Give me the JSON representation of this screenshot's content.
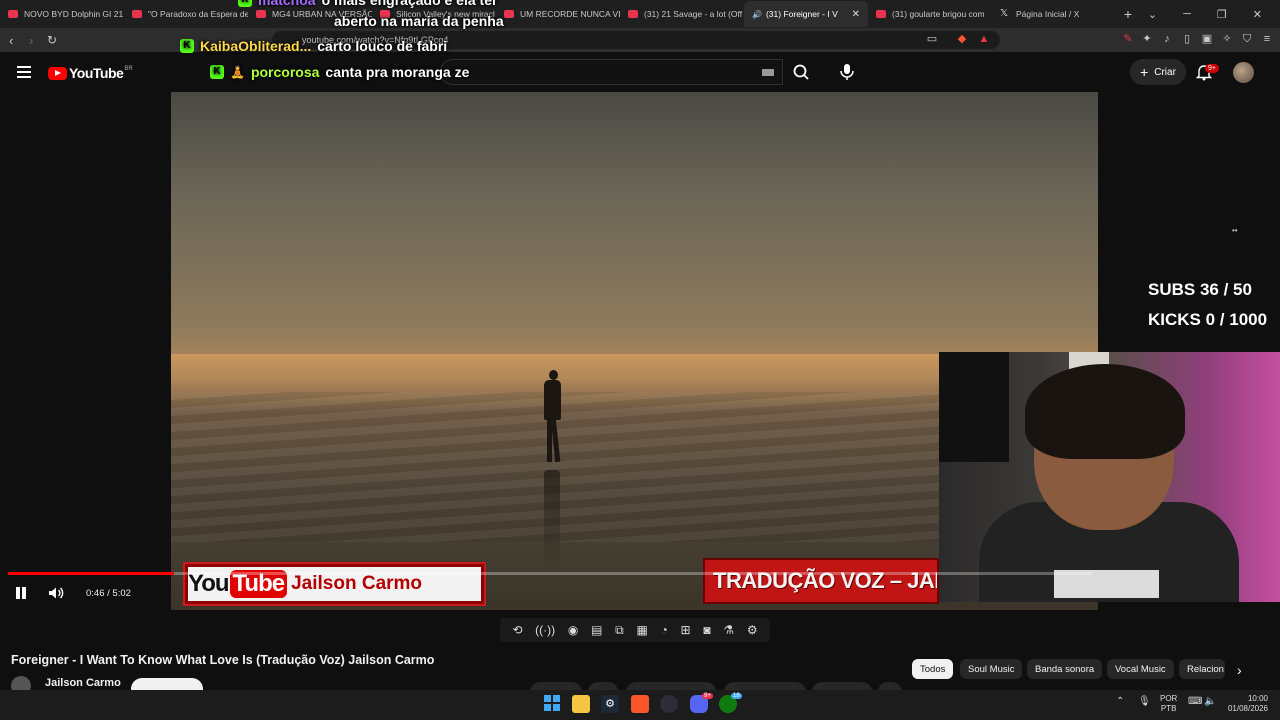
{
  "browser": {
    "tabs": [
      {
        "label": "NOVO BYD Dolphin GI 21",
        "favicon": "youtube-icon",
        "active": false
      },
      {
        "label": "\"O Paradoxo da Espera de",
        "favicon": "youtube-icon",
        "active": false
      },
      {
        "label": "MG4 URBAN NA VERSÃO",
        "favicon": "youtube-icon",
        "active": false
      },
      {
        "label": "Silicon Valley's new miracl",
        "favicon": "youtube-icon",
        "active": false
      },
      {
        "label": "UM RECORDE NUNCA VI",
        "favicon": "youtube-icon",
        "active": false
      },
      {
        "label": "(31) 21 Savage - a lot (Off",
        "favicon": "youtube-icon",
        "active": false
      },
      {
        "label": "(31) Foreigner - I V",
        "favicon": "youtube-icon",
        "active": true
      },
      {
        "label": "(31) goularte brigou com",
        "favicon": "youtube-icon",
        "active": false
      },
      {
        "label": "Página Inicial / X",
        "favicon": "x-icon",
        "active": false
      }
    ],
    "url": "youtube.com/watch?v=Nfq9tLGPcg4"
  },
  "youtube": {
    "logo_text": "YouTube",
    "country_code": "BR",
    "create_label": "Criar",
    "notification_count": "9+"
  },
  "stream_chat": [
    {
      "user": "matchoa",
      "message": "o mais engraçado é ela ter"
    },
    {
      "user": "",
      "message": "aberto na maria da penha"
    },
    {
      "user": "KaibaObliterad...",
      "message": "carto louco de fabri"
    },
    {
      "user": "porcorosa",
      "message": "canta pra moranga ze"
    }
  ],
  "overlays": {
    "banner_youtube_1": "You",
    "banner_youtube_2": "Tube",
    "banner_name": "Jailson Carmo",
    "traducao": "TRADUÇÃO VOZ – JAILSON",
    "subs": "SUBS 36 / 50",
    "kicks": "KICKS 0 / 1000"
  },
  "player": {
    "current_time": "0:46",
    "duration": "5:02",
    "time_display": "0:46 / 5:02",
    "progress": 0.153
  },
  "video": {
    "title": "Foreigner - I Want To Know What Love Is (Tradução Voz) Jailson Carmo",
    "channel": "Jailson Carmo"
  },
  "chips": [
    "Todos",
    "Soul Music",
    "Banda sonora",
    "Vocal Music",
    "Relacion"
  ],
  "taskbar": {
    "lang": "POR",
    "layout": "PTB",
    "time": "10:00",
    "date": "01/08/2026",
    "discord_badge": "9+",
    "xbox_badge": "18"
  },
  "colors": {
    "accent": "#ff0000",
    "kick_green": "#53fc18",
    "chat_user": "#b0ff3a"
  }
}
